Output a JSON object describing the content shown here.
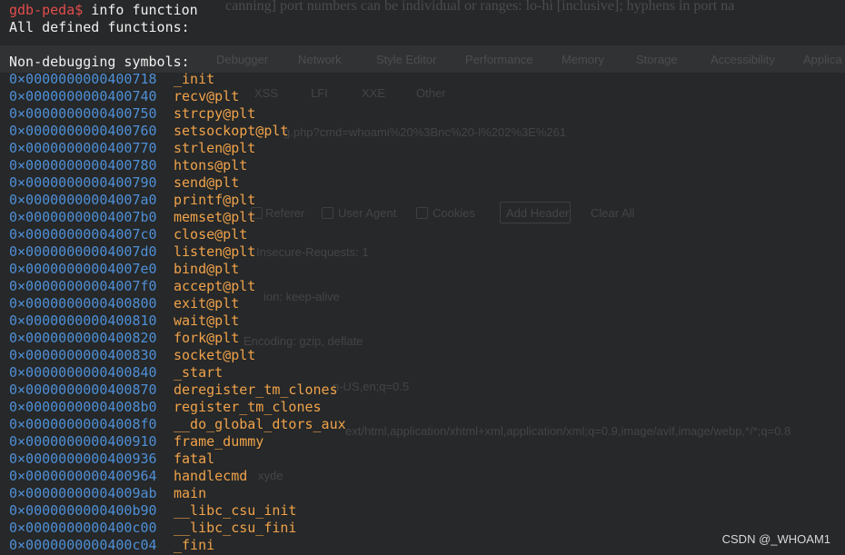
{
  "terminal": {
    "prompt": "gdb-peda$",
    "command": " info function",
    "header": "All defined functions:",
    "section": "Non-debugging symbols:",
    "symbols": [
      {
        "addr": "0×0000000000400718",
        "name": "_init"
      },
      {
        "addr": "0×0000000000400740",
        "name": "recv@plt"
      },
      {
        "addr": "0×0000000000400750",
        "name": "strcpy@plt"
      },
      {
        "addr": "0×0000000000400760",
        "name": "setsockopt@plt"
      },
      {
        "addr": "0×0000000000400770",
        "name": "strlen@plt"
      },
      {
        "addr": "0×0000000000400780",
        "name": "htons@plt"
      },
      {
        "addr": "0×0000000000400790",
        "name": "send@plt"
      },
      {
        "addr": "0×00000000004007a0",
        "name": "printf@plt"
      },
      {
        "addr": "0×00000000004007b0",
        "name": "memset@plt"
      },
      {
        "addr": "0×00000000004007c0",
        "name": "close@plt"
      },
      {
        "addr": "0×00000000004007d0",
        "name": "listen@plt"
      },
      {
        "addr": "0×00000000004007e0",
        "name": "bind@plt"
      },
      {
        "addr": "0×00000000004007f0",
        "name": "accept@plt"
      },
      {
        "addr": "0×0000000000400800",
        "name": "exit@plt"
      },
      {
        "addr": "0×0000000000400810",
        "name": "wait@plt"
      },
      {
        "addr": "0×0000000000400820",
        "name": "fork@plt"
      },
      {
        "addr": "0×0000000000400830",
        "name": "socket@plt"
      },
      {
        "addr": "0×0000000000400840",
        "name": "_start"
      },
      {
        "addr": "0×0000000000400870",
        "name": "deregister_tm_clones"
      },
      {
        "addr": "0×00000000004008b0",
        "name": "register_tm_clones"
      },
      {
        "addr": "0×00000000004008f0",
        "name": "__do_global_dtors_aux"
      },
      {
        "addr": "0×0000000000400910",
        "name": "frame_dummy"
      },
      {
        "addr": "0×0000000000400936",
        "name": "fatal"
      },
      {
        "addr": "0×0000000000400964",
        "name": "handlecmd"
      },
      {
        "addr": "0×00000000004009ab",
        "name": "main"
      },
      {
        "addr": "0×0000000000400b90",
        "name": "__libc_csu_init"
      },
      {
        "addr": "0×0000000000400c00",
        "name": "__libc_csu_fini"
      },
      {
        "addr": "0×0000000000400c04",
        "name": "_fini"
      }
    ]
  },
  "background": {
    "top_text": "canning] port numbers can be individual or ranges: lo-hi [inclusive]; hyphens in port na",
    "devtools_tabs": [
      "Debugger",
      "Network",
      "Style Editor",
      "Performance",
      "Memory",
      "Storage",
      "Accessibility",
      "Applica"
    ],
    "filters": [
      "XSS",
      "LFI",
      "XXE",
      "Other"
    ],
    "url": "g.php?cmd=whoami%20%3Bnc%20-l%202%3E%261",
    "checkboxes": [
      "Referer",
      "User Agent",
      "Cookies"
    ],
    "add_header": "Add Header",
    "clear_all": "Clear All",
    "headers": [
      "Insecure-Requests: 1",
      "ion: keep-alive",
      "Encoding: gzip, deflate",
      "n-US,en;q=0.5",
      "ext/html,application/xhtml+xml,application/xml;q=0.9,image/avif,image/webp,*/*;q=0.8",
      "xyde"
    ]
  },
  "watermark": "CSDN @_WHOAM1"
}
